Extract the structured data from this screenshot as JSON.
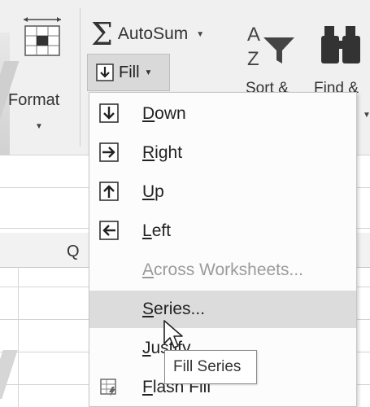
{
  "ribbon": {
    "format": {
      "label": "Format",
      "icon": "format-cells-icon"
    },
    "autosum": {
      "label": "AutoSum",
      "icon": "sigma-icon"
    },
    "fill": {
      "label": "Fill",
      "icon": "fill-down-icon"
    },
    "sort": {
      "label": "Sort &",
      "icon": "sort-filter-icon"
    },
    "find": {
      "label": "Find &",
      "icon": "binoculars-icon"
    }
  },
  "sheet": {
    "column_label": "Q"
  },
  "fill_menu": {
    "items": [
      {
        "label_first": "D",
        "label_rest": "own",
        "icon": "arrow-down-icon",
        "enabled": true
      },
      {
        "label_first": "R",
        "label_rest": "ight",
        "icon": "arrow-right-icon",
        "enabled": true
      },
      {
        "label_first": "U",
        "label_rest": "p",
        "icon": "arrow-up-icon",
        "enabled": true
      },
      {
        "label_first": "L",
        "label_rest": "eft",
        "icon": "arrow-left-icon",
        "enabled": true
      },
      {
        "label_first": "A",
        "label_rest": "cross Worksheets...",
        "icon": "",
        "enabled": false
      },
      {
        "label_first": "S",
        "label_rest": "eries...",
        "icon": "",
        "enabled": true,
        "highlighted": true
      },
      {
        "label_first": "J",
        "label_rest": "ustify",
        "icon": "",
        "enabled": true
      },
      {
        "label_first": "F",
        "label_rest": "lash Fill",
        "icon": "flash-fill-icon",
        "enabled": true
      }
    ]
  },
  "tooltip": {
    "text": "Fill Series"
  },
  "colors": {
    "highlight": "#dcdcdc",
    "disabled_text": "#9b9b9b",
    "ribbon_bg": "#f0f0f0"
  }
}
